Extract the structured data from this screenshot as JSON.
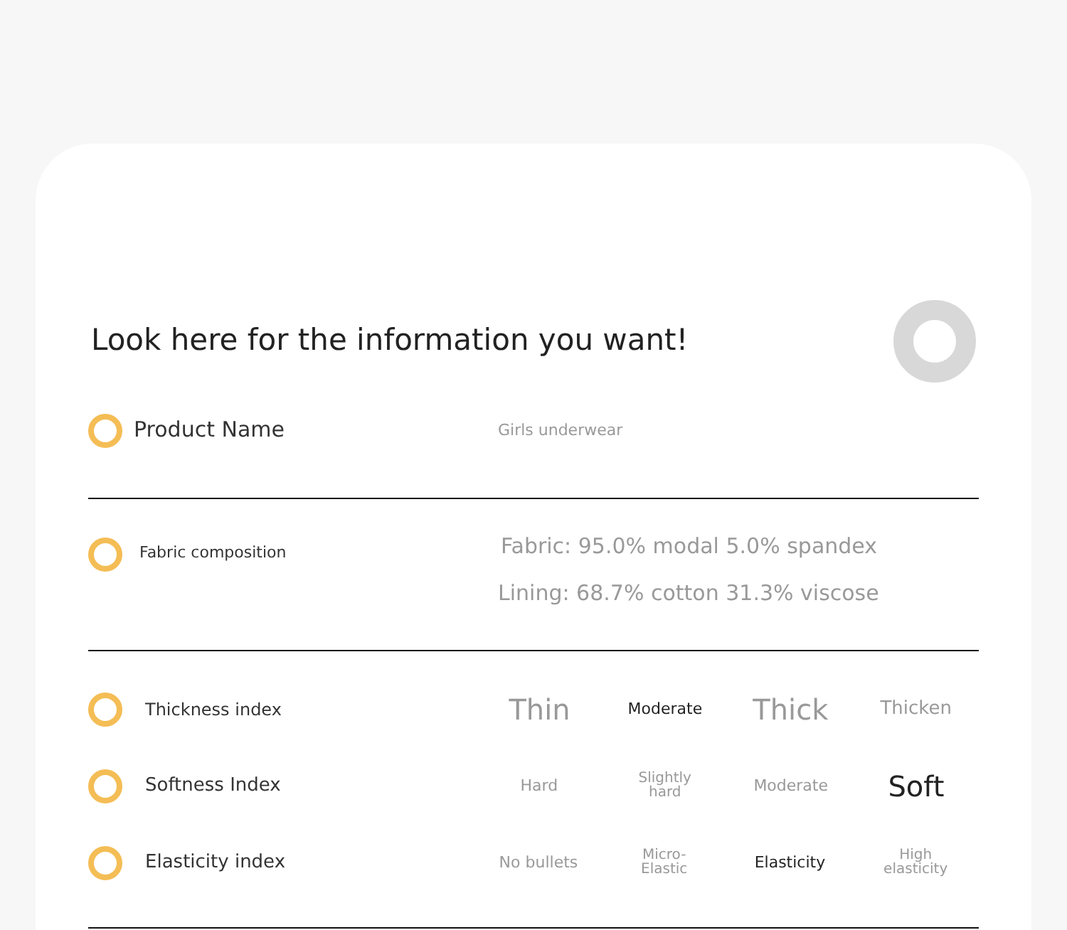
{
  "heading": "Look here for the information you want!",
  "info_rows": [
    {
      "label": "Product Name",
      "kind": "large",
      "values": [
        "Girls underwear"
      ]
    },
    {
      "label": "Fabric composition",
      "kind": "small",
      "values": [
        "Fabric: 95.0% modal 5.0% spandex",
        "Lining: 68.7% cotton 31.3% viscose"
      ]
    }
  ],
  "index_rows": [
    {
      "label": "Thickness index",
      "options": [
        {
          "text": "Thin",
          "selected": false
        },
        {
          "text": "Moderate",
          "selected": true
        },
        {
          "text": "Thick",
          "selected": false
        },
        {
          "text": "Thicken",
          "selected": false
        }
      ]
    },
    {
      "label": "Softness Index",
      "options": [
        {
          "text": "Hard",
          "selected": false
        },
        {
          "text": "Slightly hard",
          "selected": false
        },
        {
          "text": "Moderate",
          "selected": false
        },
        {
          "text": "Soft",
          "selected": true
        }
      ]
    },
    {
      "label": "Elasticity index",
      "options": [
        {
          "text": "No bullets",
          "selected": false
        },
        {
          "text": "Micro-Elastic",
          "selected": false
        },
        {
          "text": "Elasticity",
          "selected": true
        },
        {
          "text": "High elasticity",
          "selected": false
        }
      ]
    }
  ]
}
